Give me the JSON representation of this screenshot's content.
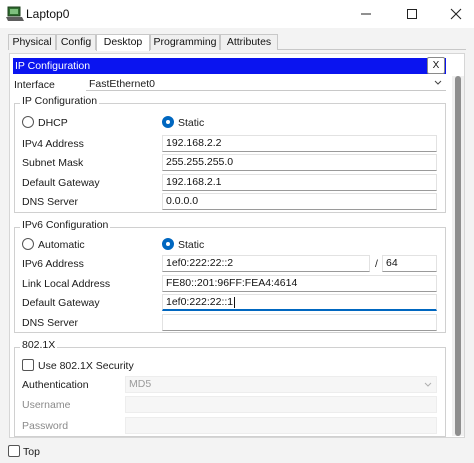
{
  "window": {
    "title": "Laptop0"
  },
  "tabs": [
    {
      "label": "Physical"
    },
    {
      "label": "Config"
    },
    {
      "label": "Desktop"
    },
    {
      "label": "Programming"
    },
    {
      "label": "Attributes"
    }
  ],
  "active_tab": "Desktop",
  "header": {
    "title": "IP Configuration",
    "close_label": "X"
  },
  "interface": {
    "label": "Interface",
    "value": "FastEthernet0"
  },
  "ipv4": {
    "title": "IP Configuration",
    "dhcp_label": "DHCP",
    "static_label": "Static",
    "mode": "Static",
    "address_label": "IPv4 Address",
    "address": "192.168.2.2",
    "mask_label": "Subnet Mask",
    "mask": "255.255.255.0",
    "gateway_label": "Default Gateway",
    "gateway": "192.168.2.1",
    "dns_label": "DNS Server",
    "dns": "0.0.0.0"
  },
  "ipv6": {
    "title": "IPv6 Configuration",
    "automatic_label": "Automatic",
    "static_label": "Static",
    "mode": "Static",
    "address_label": "IPv6 Address",
    "address": "1ef0:222:22::2",
    "slash": "/",
    "prefix": "64",
    "link_local_label": "Link Local Address",
    "link_local": "FE80::201:96FF:FEA4:4614",
    "gateway_label": "Default Gateway",
    "gateway": "1ef0:222:22::1",
    "dns_label": "DNS Server",
    "dns": ""
  },
  "dot1x": {
    "title": "802.1X",
    "use_label": "Use 802.1X Security",
    "use_checked": false,
    "auth_label": "Authentication",
    "auth_value": "MD5",
    "username_label": "Username",
    "username": "",
    "password_label": "Password",
    "password": ""
  },
  "footer": {
    "top_label": "Top",
    "top_checked": false
  },
  "colors": {
    "header_bg": "#0a14f0",
    "accent": "#0067c0"
  }
}
